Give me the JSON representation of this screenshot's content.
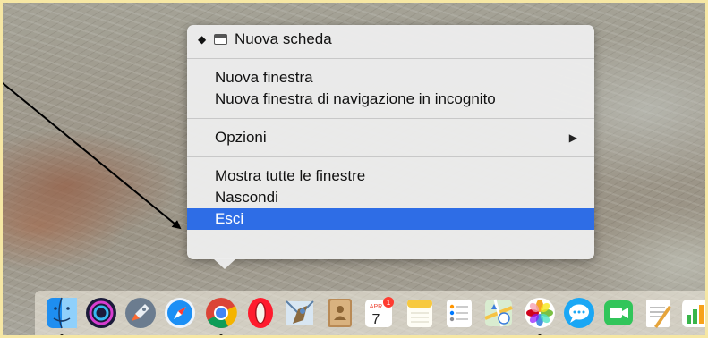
{
  "context_menu": {
    "items": [
      {
        "label": "Nuova scheda",
        "marker": "◆",
        "icon": "tab-icon"
      },
      {
        "label": "Nuova finestra"
      },
      {
        "label": "Nuova finestra di navigazione in incognito"
      },
      {
        "label": "Opzioni",
        "submenu_indicator": "▶"
      },
      {
        "label": "Mostra tutte le finestre"
      },
      {
        "label": "Nascondi"
      },
      {
        "label": "Esci",
        "selected": true
      }
    ]
  },
  "dock": {
    "apps": [
      {
        "icon": "finder-icon",
        "running": true
      },
      {
        "icon": "siri-icon",
        "running": false
      },
      {
        "icon": "launchpad-icon",
        "running": false
      },
      {
        "icon": "safari-icon",
        "running": false
      },
      {
        "icon": "chrome-icon",
        "running": true
      },
      {
        "icon": "opera-icon",
        "running": false
      },
      {
        "icon": "mail-icon",
        "running": false
      },
      {
        "icon": "contacts-icon",
        "running": false
      },
      {
        "icon": "calendar-icon",
        "running": false,
        "month": "APR",
        "day": "7",
        "badge": "1"
      },
      {
        "icon": "notes-icon",
        "running": false
      },
      {
        "icon": "reminders-icon",
        "running": false
      },
      {
        "icon": "maps-icon",
        "running": false
      },
      {
        "icon": "photos-icon",
        "running": true
      },
      {
        "icon": "messages-icon",
        "running": false
      },
      {
        "icon": "facetime-icon",
        "running": false
      },
      {
        "icon": "textedit-icon",
        "running": false
      },
      {
        "icon": "numbers-icon",
        "running": false
      }
    ]
  },
  "colors": {
    "selection": "#2e6de6",
    "screenshot_border": "#f6e7a4",
    "annotation_arrow": "#000000"
  }
}
